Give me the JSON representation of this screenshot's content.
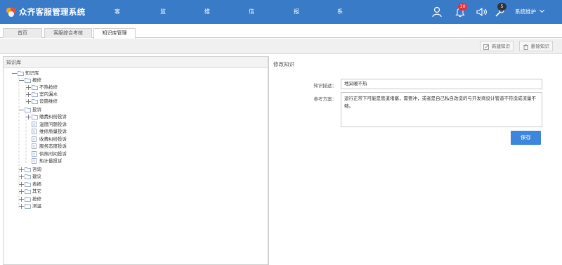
{
  "app": {
    "title": "众齐客服管理系统"
  },
  "nav": {
    "items": [
      {
        "label": "客服中心"
      },
      {
        "label": "监控中心"
      },
      {
        "label": "维修中心"
      },
      {
        "label": "信息管理"
      },
      {
        "label": "报表中心"
      },
      {
        "label": "系统设置"
      }
    ],
    "notifications_count": "10",
    "tools_count": "5",
    "user_label": "系统维护"
  },
  "tabs": [
    {
      "label": "首页"
    },
    {
      "label": "客服综合考核"
    },
    {
      "label": "知识库管理"
    }
  ],
  "toolbar": {
    "new_label": "新建知识",
    "delete_label": "删除知识"
  },
  "tree": {
    "header": "知识库",
    "root": "知识库",
    "nodes": [
      {
        "label": "报修"
      },
      {
        "label": "不热抢修"
      },
      {
        "label": "室内漏水"
      },
      {
        "label": "设施维修"
      },
      {
        "label": "投诉"
      },
      {
        "label": "缴费纠纷投诉"
      },
      {
        "label": "温度问题投诉"
      },
      {
        "label": "维修质量投诉"
      },
      {
        "label": "收费纠纷投诉"
      },
      {
        "label": "服务态度投诉"
      },
      {
        "label": "供热时间投诉"
      },
      {
        "label": "热计量投诉"
      },
      {
        "label": "咨询"
      },
      {
        "label": "建议"
      },
      {
        "label": "表扬"
      },
      {
        "label": "其它"
      },
      {
        "label": "抢修"
      },
      {
        "label": "测温"
      }
    ]
  },
  "form": {
    "section_title": "修改知识",
    "desc_label": "知识描述：",
    "desc_value": "地采暖不热",
    "plan_label": "参考方案：",
    "plan_value": "运行正常下可能是管道堵塞，需要冲，或者是自己私自改造的与开发商设计管道不符造成流量不够。",
    "save_label": "保存"
  }
}
